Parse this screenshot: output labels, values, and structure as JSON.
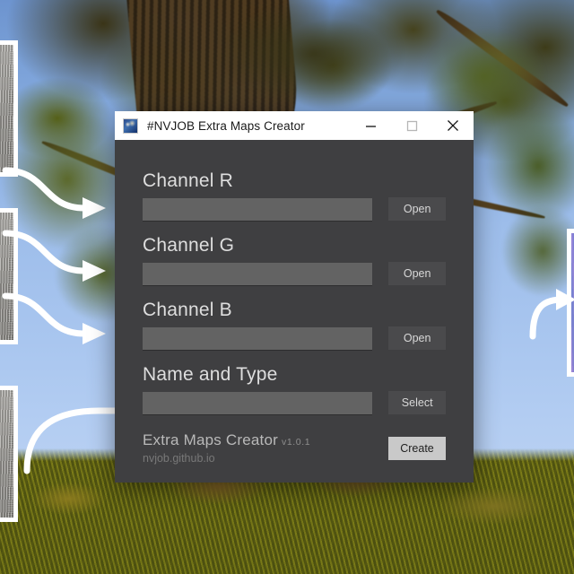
{
  "window": {
    "title": "#NVJOB Extra Maps Creator",
    "icon": "app-thumbnail-icon",
    "controls": {
      "minimize": "minimize-icon",
      "maximize": "maximize-icon",
      "close": "close-icon"
    },
    "colors": {
      "window_bg": "#3f3f41",
      "titlebar_bg": "#ffffff",
      "input_bg": "#636363",
      "button_bg": "#4a4a4c",
      "create_button_bg": "#c9c9c9",
      "label_text": "#dedede"
    }
  },
  "fields": [
    {
      "label": "Channel R",
      "value": "",
      "placeholder": "",
      "button": "Open"
    },
    {
      "label": "Channel G",
      "value": "",
      "placeholder": "",
      "button": "Open"
    },
    {
      "label": "Channel B",
      "value": "",
      "placeholder": "",
      "button": "Open"
    },
    {
      "label": "Name and Type",
      "value": "",
      "placeholder": "",
      "button": "Select"
    }
  ],
  "footer": {
    "app_name": "Extra Maps Creator",
    "version": "v1.0.1",
    "url": "nvjob.github.io",
    "create_label": "Create"
  },
  "background": {
    "scene": "tree-canopy-sky-grass-photo",
    "panels": [
      {
        "name": "texture-swatch-left-top",
        "kind": "grayscale"
      },
      {
        "name": "texture-swatch-left-middle",
        "kind": "grayscale"
      },
      {
        "name": "texture-swatch-left-bottom",
        "kind": "grayscale"
      },
      {
        "name": "texture-swatch-right",
        "kind": "normal-map"
      }
    ],
    "arrows": [
      {
        "name": "arrow-left-top-to-window"
      },
      {
        "name": "arrow-left-middle-to-window"
      },
      {
        "name": "arrow-left-bottom-to-window"
      },
      {
        "name": "arrow-window-to-right-panel"
      }
    ]
  }
}
